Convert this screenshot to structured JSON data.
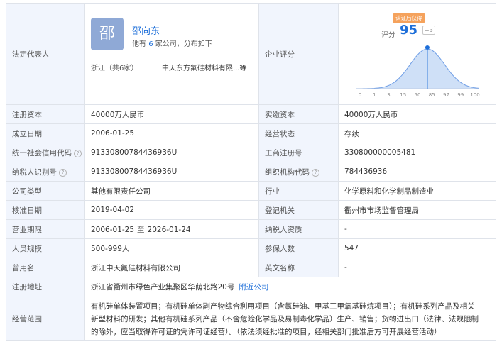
{
  "legal_rep": {
    "label": "法定代表人",
    "avatar_char": "邵",
    "name": "邵向东",
    "sub_prefix": "他有",
    "sub_count": "6",
    "sub_suffix": "家公司，分布如下",
    "region": "浙江（共6家）",
    "companies": "中天东方氟硅材料有限...等"
  },
  "score": {
    "label": "企业评分",
    "badge": "认证后获得",
    "score_label": "评分",
    "value": "95",
    "delta": "+3",
    "ticks": [
      "0",
      "1",
      "3",
      "15",
      "50",
      "85",
      "97",
      "99",
      "100"
    ],
    "marker_fraction": 0.58,
    "colors": {
      "accent": "#1e6fd9",
      "curve": "#6f9ee6",
      "fill": "#cfe0f7"
    }
  },
  "rows": [
    {
      "k1": "注册资本",
      "v1": "40000万人民币",
      "k2": "实缴资本",
      "v2": "40000万人民币"
    },
    {
      "k1": "成立日期",
      "v1": "2006-01-25",
      "k2": "经营状态",
      "v2": "存续"
    },
    {
      "k1": "统一社会信用代码",
      "v1": "91330800784436936U",
      "k2": "工商注册号",
      "v2": "330800000005481"
    },
    {
      "k1": "纳税人识别号",
      "v1": "91330800784436936U",
      "k2": "组织机构代码",
      "v2": "784436936"
    },
    {
      "k1": "公司类型",
      "v1": "其他有限责任公司",
      "k2": "行业",
      "v2": "化学原料和化学制品制造业"
    },
    {
      "k1": "核准日期",
      "v1": "2019-04-02",
      "k2": "登记机关",
      "v2": "衢州市市场监督管理局"
    },
    {
      "k1": "营业期限",
      "v1a": "2006-01-25",
      "v1sep": "至",
      "v1b": "2026-01-24",
      "k2": "纳税人资质",
      "v2": "-"
    },
    {
      "k1": "人员规模",
      "v1": "500-999人",
      "k2": "参保人数",
      "v2": "547"
    },
    {
      "k1": "曾用名",
      "v1": "浙江中天氟硅材料有限公司",
      "k2": "英文名称",
      "v2": "-"
    }
  ],
  "address": {
    "label": "注册地址",
    "value": "浙江省衢州市绿色产业集聚区华荫北路20号",
    "link": "附近公司"
  },
  "scope": {
    "label": "经营范围",
    "line1": "有机硅单体装置项目；有机硅单体副产物综合利用项目（含氯硅油、甲基三甲氧基硅烷项目）；有机硅系列产品及相关",
    "line2": "新型材料的研发；其他有机硅系列产品（不含危险化学品及易制毒化学品）生产、销售；货物进出口（法律、法规限制",
    "line3": "的除外，应当取得许可证的凭许可证经营）。（依法须经批准的项目，经相关部门批准后方可开展经营活动）"
  }
}
